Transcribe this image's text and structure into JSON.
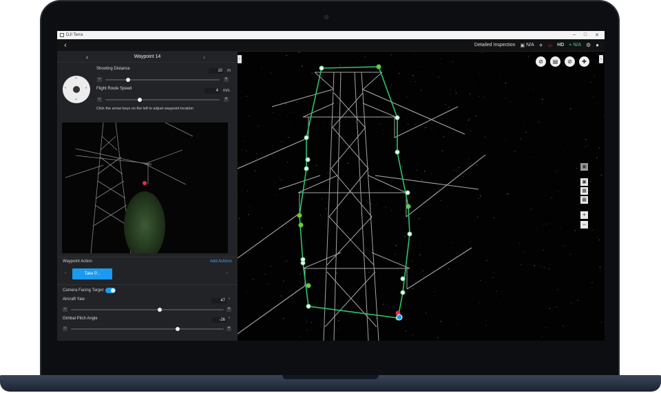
{
  "window": {
    "title": "DJI Terra",
    "controls": [
      "–",
      "□",
      "✕"
    ]
  },
  "topbar": {
    "mode": "Detailed Inspection",
    "stats": [
      {
        "icon": "rtk-icon",
        "glyph": "▣",
        "value": "N/A"
      },
      {
        "icon": "satellite-icon",
        "glyph": "✈",
        "value": ""
      },
      {
        "icon": "battery-icon",
        "glyph": "▭",
        "value": ""
      },
      {
        "icon": "hd-signal-icon",
        "glyph": "HD",
        "value": ""
      },
      {
        "icon": "gps-icon",
        "glyph": "⌖",
        "value": "N/A"
      }
    ]
  },
  "left_panel": {
    "waypoint_title": "Waypoint 14",
    "shooting_distance": {
      "label": "Shooting Distance",
      "value": "10",
      "unit": "m",
      "level": 0.2
    },
    "flight_speed": {
      "label": "Flight Route Speed",
      "value": "4",
      "unit": "m/s",
      "level": 0.3
    },
    "hint": "Click the arrow keys on the left to adjust waypoint location",
    "waypoint_action": {
      "title": "Waypoint Action",
      "add_label": "Add Actions",
      "action_label": "Take P..."
    },
    "camera_facing": {
      "label": "Camera Facing Target",
      "on": true
    },
    "aircraft_yaw": {
      "label": "Aircraft Yaw",
      "value": "47",
      "level": 0.58
    },
    "gimbal_pitch": {
      "label": "Gimbal Pitch Angle",
      "value": "-26",
      "level": 0.7
    }
  },
  "colors": {
    "accent": "#1a9bf0",
    "route": "#2ec66a",
    "waypoint_red": "#e0304a"
  }
}
